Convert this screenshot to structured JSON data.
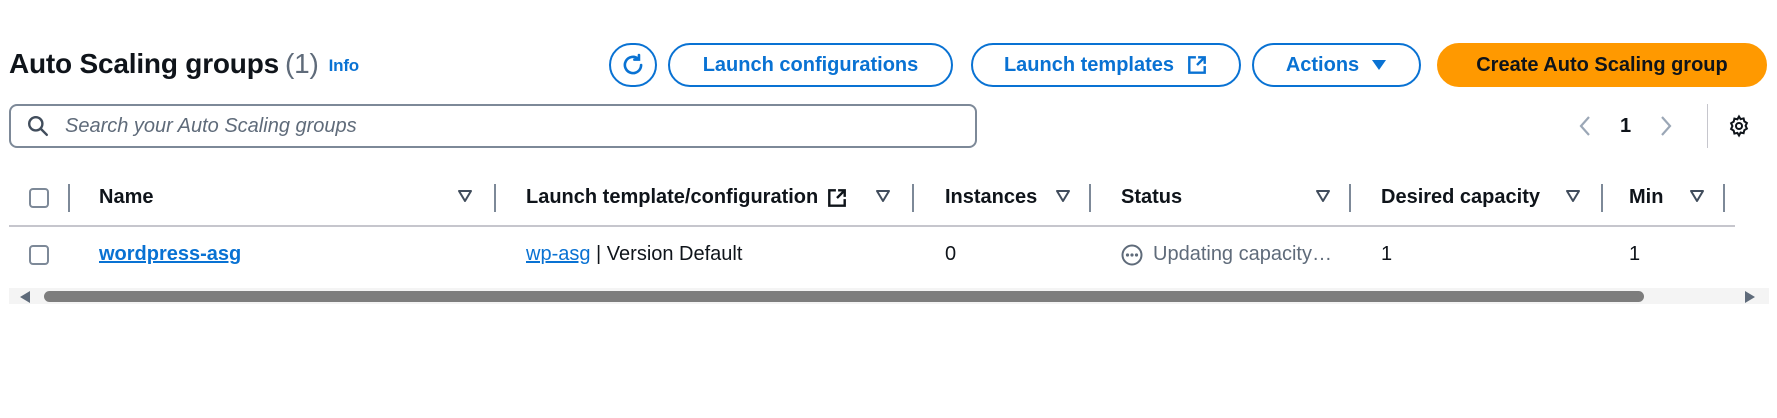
{
  "header": {
    "title": "Auto Scaling groups",
    "count": "(1)",
    "info": "Info",
    "buttons": {
      "launch_configurations": "Launch configurations",
      "launch_templates": "Launch templates",
      "actions": "Actions",
      "create": "Create Auto Scaling group"
    }
  },
  "search": {
    "placeholder": "Search your Auto Scaling groups"
  },
  "pagination": {
    "current_page": "1"
  },
  "table": {
    "columns": [
      "Name",
      "Launch template/configuration",
      "Instances",
      "Status",
      "Desired capacity",
      "Min"
    ],
    "rows": [
      {
        "name": "wordpress-asg",
        "template_link": "wp-asg",
        "template_version": " | Version Default",
        "instances": "0",
        "status": "Updating capacity…",
        "desired_capacity": "1",
        "min": "1"
      }
    ]
  },
  "colors": {
    "accent": "#0972d3",
    "primary_button": "#ff9900",
    "text": "#0f141a",
    "muted": "#5f6b7a"
  },
  "icons": [
    "refresh-icon",
    "external-link-icon",
    "caret-down-icon",
    "search-icon",
    "chevron-left-icon",
    "chevron-right-icon",
    "settings-icon",
    "sort-icon",
    "status-pending-icon"
  ]
}
